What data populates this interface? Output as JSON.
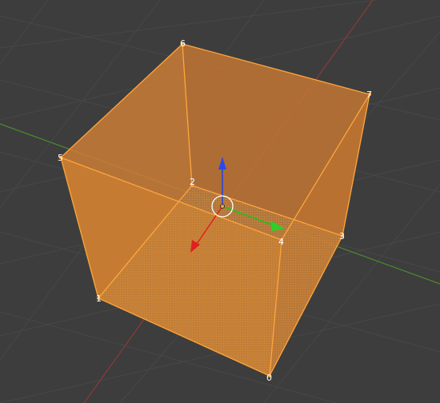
{
  "viewport": {
    "mode": "edit",
    "object": "cube",
    "colors": {
      "background": "#3d3d3d",
      "grid": "#4a4a4a",
      "x_axis": "#8a3a3a",
      "y_axis": "#4f8a2a",
      "face_fill": "#e08a30",
      "edge": "#ffa53a",
      "gizmo_x": "#e02020",
      "gizmo_y": "#20c020",
      "gizmo_z": "#2040e0"
    }
  },
  "vertices": [
    {
      "id": "0",
      "label": "0"
    },
    {
      "id": "1",
      "label": "1"
    },
    {
      "id": "2",
      "label": "2"
    },
    {
      "id": "3",
      "label": "3"
    },
    {
      "id": "4",
      "label": "4"
    },
    {
      "id": "5",
      "label": "5"
    },
    {
      "id": "6",
      "label": "6"
    },
    {
      "id": "7",
      "label": "7"
    }
  ]
}
